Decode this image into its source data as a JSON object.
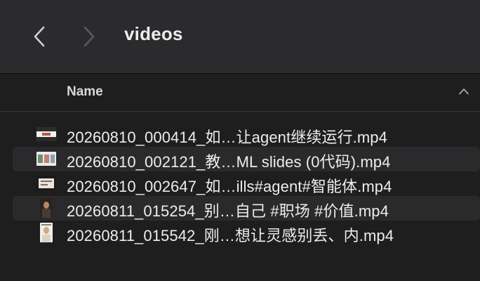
{
  "window": {
    "title": "videos",
    "back_icon": "chevron-left-icon",
    "forward_icon": "chevron-right-icon"
  },
  "header": {
    "name_label": "Name",
    "sort_icon": "chevron-up-icon"
  },
  "files": [
    {
      "name": "20260810_000414_如…让agent继续运行.mp4",
      "thumbnail": "video-thumbnail-landscape-dark"
    },
    {
      "name": "20260810_002121_教…ML slides (0代码).mp4",
      "thumbnail": "video-thumbnail-landscape-light"
    },
    {
      "name": "20260810_002647_如…ills#agent#智能体.mp4",
      "thumbnail": "video-thumbnail-landscape-dark"
    },
    {
      "name": "20260811_015254_别…自己 #职场 #价值.mp4",
      "thumbnail": "video-thumbnail-portrait-dark"
    },
    {
      "name": "20260811_015542_刚…想让灵感别丢、内.mp4",
      "thumbnail": "video-thumbnail-portrait-light"
    }
  ],
  "colors": {
    "background": "#1e1e1e",
    "toolbar": "#2b2b2d",
    "alt_row": "#2a2a2c",
    "text": "#ededed"
  }
}
